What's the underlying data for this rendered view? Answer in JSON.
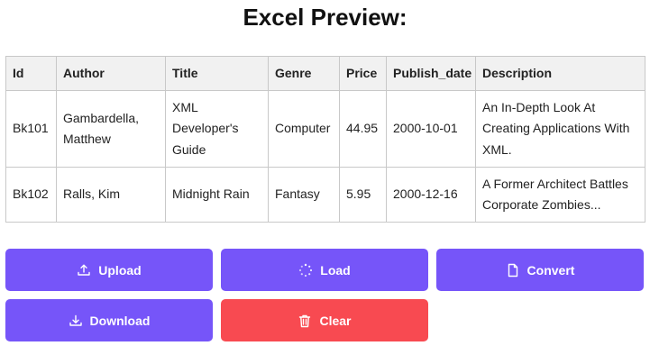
{
  "page": {
    "title": "Excel Preview:"
  },
  "table": {
    "headers": [
      "Id",
      "Author",
      "Title",
      "Genre",
      "Price",
      "Publish_date",
      "Description"
    ],
    "rows": [
      [
        "Bk101",
        "Gambardella, Matthew",
        "XML Developer's Guide",
        "Computer",
        "44.95",
        "2000-10-01",
        "An In-Depth Look At Creating Applications With XML."
      ],
      [
        "Bk102",
        "Ralls, Kim",
        "Midnight Rain",
        "Fantasy",
        "5.95",
        "2000-12-16",
        "A Former Architect Battles Corporate Zombies..."
      ]
    ]
  },
  "buttons": {
    "upload": {
      "label": "Upload",
      "icon": "upload-icon"
    },
    "load": {
      "label": "Load",
      "icon": "spinner-icon"
    },
    "convert": {
      "label": "Convert",
      "icon": "file-icon"
    },
    "download": {
      "label": "Download",
      "icon": "download-icon"
    },
    "clear": {
      "label": "Clear",
      "icon": "trash-icon"
    }
  },
  "colors": {
    "primary": "#7655f9",
    "danger": "#f84a51",
    "header_bg": "#f1f1f1",
    "border": "#c8c8c8"
  }
}
